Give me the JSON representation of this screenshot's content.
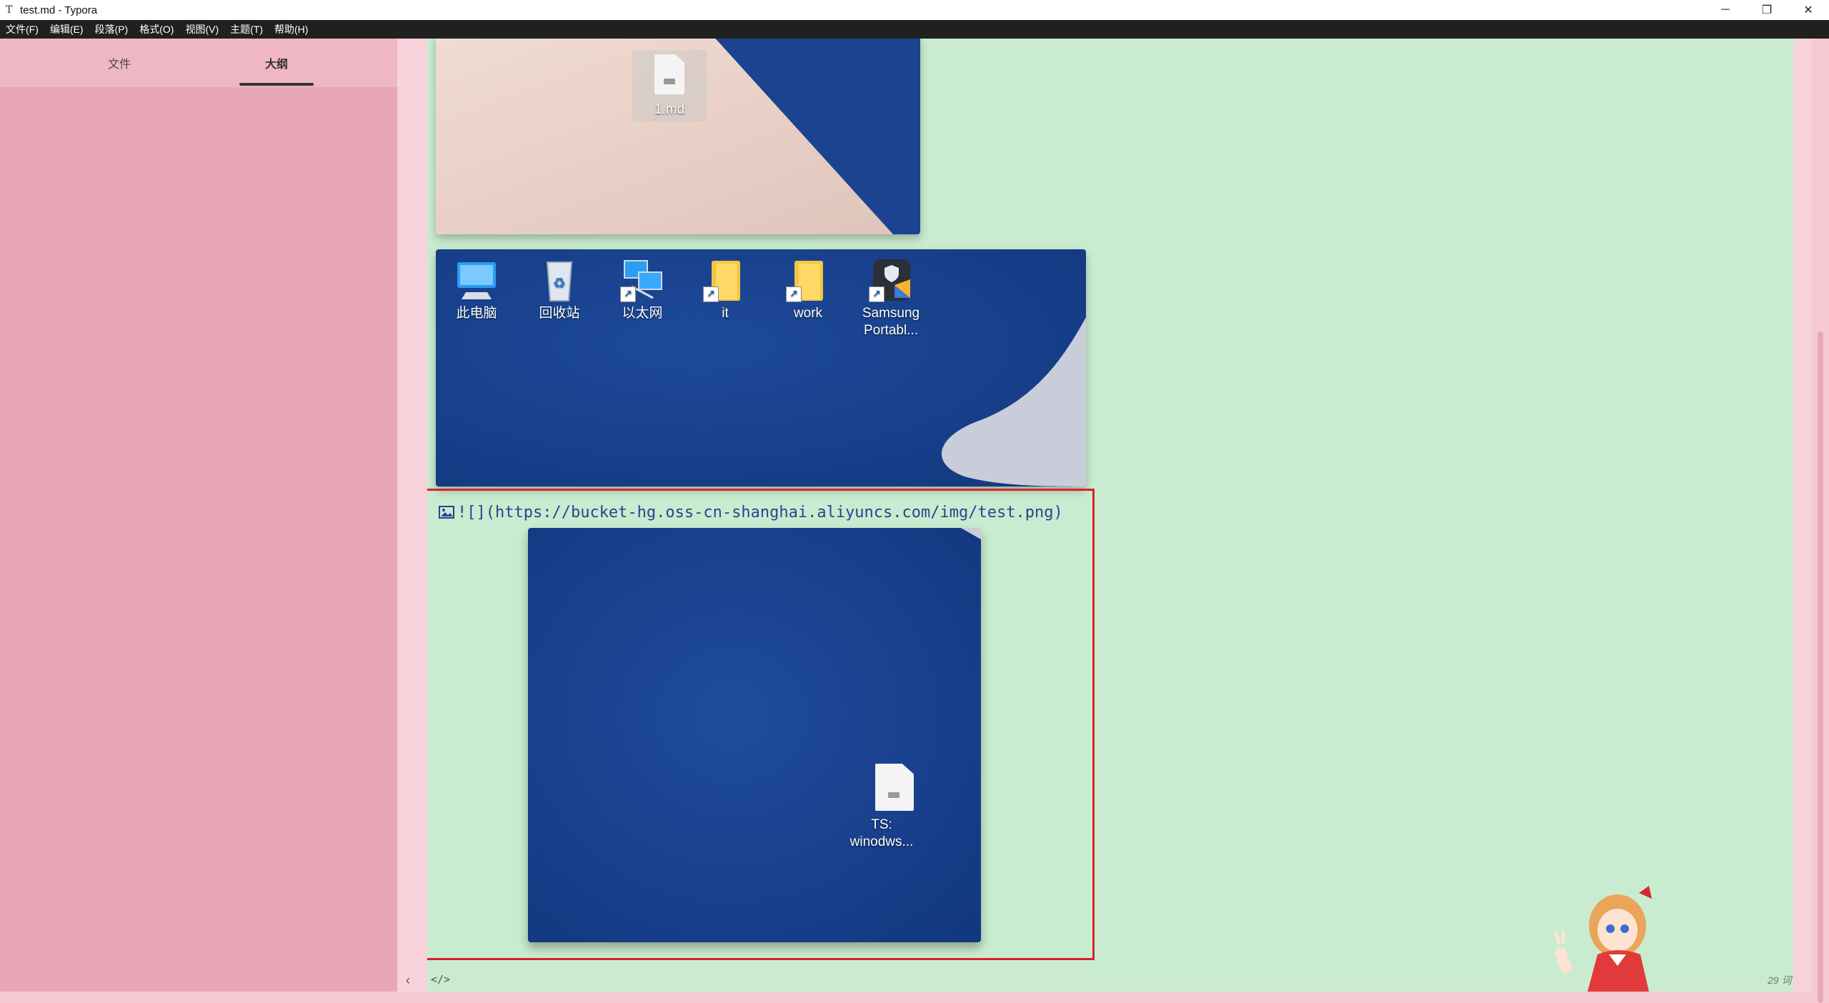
{
  "window": {
    "title": "test.md - Typora",
    "app_icon_glyph": "T",
    "controls": [
      "─",
      "❐",
      "✕"
    ]
  },
  "menu": [
    "文件(F)",
    "编辑(E)",
    "段落(P)",
    "格式(O)",
    "视图(V)",
    "主题(T)",
    "帮助(H)"
  ],
  "sidebar": {
    "tabs": [
      {
        "label": "文件",
        "active": false
      },
      {
        "label": "大纲",
        "active": true
      }
    ]
  },
  "editor": {
    "image1_desktop_file": "1.md",
    "image2_icons": [
      "此电脑",
      "回收站",
      "以太网",
      "it",
      "work",
      "Samsung Portabl..."
    ],
    "image_markdown": {
      "prefix": "!",
      "alt_box": "[]",
      "url": "(https://bucket-hg.oss-cn-shanghai.aliyuncs.com/img/test.png)"
    },
    "image3_file_line1": "TS:",
    "image3_file_line2": "winodws..."
  },
  "footer": {
    "collapse_glyph": "‹",
    "source_mode_glyph": "</>",
    "word_count": "29 词"
  },
  "colors": {
    "sidebar_bg": "#e8a7b8",
    "editor_bg": "#c9ecd0",
    "menubar_bg": "#202020",
    "selection_border": "#d9202a",
    "markdown_text": "#2f3f8f"
  }
}
